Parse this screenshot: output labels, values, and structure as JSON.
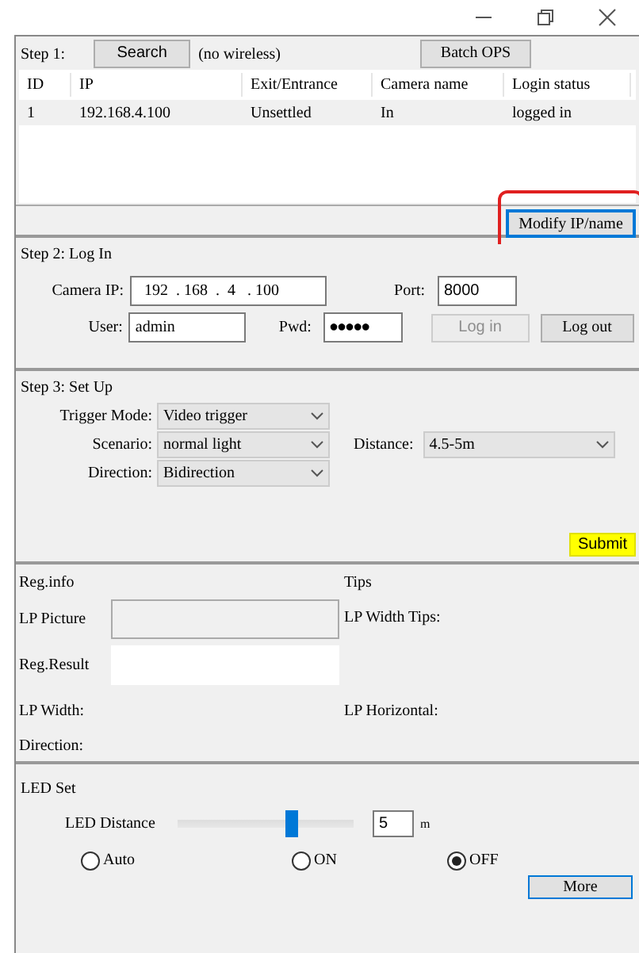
{
  "step1": {
    "label": "Step 1:",
    "search_button": "Search",
    "status": "(no wireless)",
    "batch_button": "Batch OPS",
    "table": {
      "columns": [
        "ID",
        "IP",
        "Exit/Entrance",
        "Camera name",
        "Login status"
      ],
      "rows": [
        [
          "1",
          "192.168.4.100",
          "Unsettled",
          "In",
          "logged in"
        ]
      ]
    },
    "modify_button": {
      "label": "Modify IP/name",
      "highlighted": true
    }
  },
  "step2": {
    "title": "Step 2: Log In",
    "camera_ip": {
      "label": "Camera IP:",
      "value": "192  . 168  .  4   . 100"
    },
    "port": {
      "label": "Port:",
      "value": "8000"
    },
    "user": {
      "label": "User:",
      "value": "admin"
    },
    "pwd": {
      "label": "Pwd:",
      "value": "●●●●●"
    },
    "login_button": {
      "label": "Log in",
      "disabled": true
    },
    "logout_button": {
      "label": "Log out",
      "disabled": false
    }
  },
  "step3": {
    "title": "Step 3: Set Up",
    "selects": [
      {
        "label": "Trigger Mode:",
        "value": "Video trigger"
      },
      {
        "label": "Scenario:",
        "value": "normal light"
      },
      {
        "label": "Direction:",
        "value": "Bidirection"
      }
    ],
    "distance": {
      "label": "Distance:",
      "value": "4.5-5m"
    },
    "submit_button": "Submit"
  },
  "reg_info": {
    "title": "Reg.info",
    "lp_picture": "LP Picture",
    "reg_result": "Reg.Result",
    "lp_width": "LP Width:",
    "direction": "Direction:",
    "tips_title": "Tips",
    "lp_width_tips": "LP Width Tips:",
    "lp_horizontal": "LP Horizontal:"
  },
  "led": {
    "title": "LED Set",
    "distance_label": "LED Distance",
    "level": 0.65,
    "value": "5",
    "unit": "m",
    "modes": [
      {
        "label": "Auto",
        "selected": false
      },
      {
        "label": "ON",
        "selected": false
      },
      {
        "label": "OFF",
        "selected": true
      }
    ],
    "more_button": "More"
  }
}
